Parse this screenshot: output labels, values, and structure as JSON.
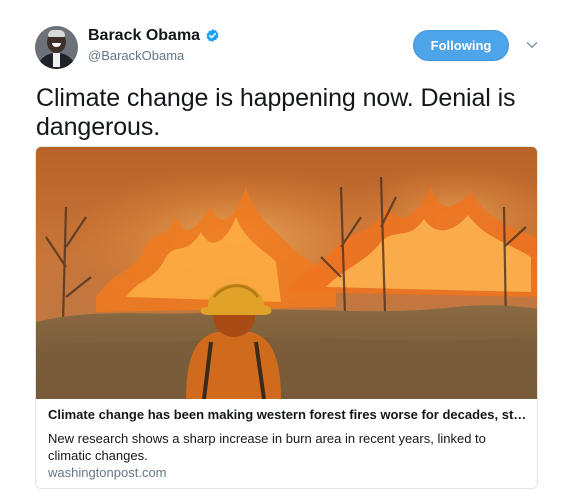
{
  "author": {
    "name": "Barack Obama",
    "handle": "@BarackObama",
    "verified": true
  },
  "actions": {
    "follow_label": "Following",
    "menu_icon": "chevron-down-icon"
  },
  "tweet": {
    "text": "Climate change is happening now. Denial is dangerous."
  },
  "card": {
    "image_subject": "firefighter before wildfire",
    "title": "Climate change has been making western forest fires worse for decades, stu...",
    "description": "New research shows a sharp increase in burn area in recent years, linked to climatic changes.",
    "domain": "washingtonpost.com"
  },
  "colors": {
    "accent": "#4ea4e8",
    "verified_badge": "#1da1f2",
    "secondary_text": "#657786",
    "border": "#e1e8ed"
  }
}
